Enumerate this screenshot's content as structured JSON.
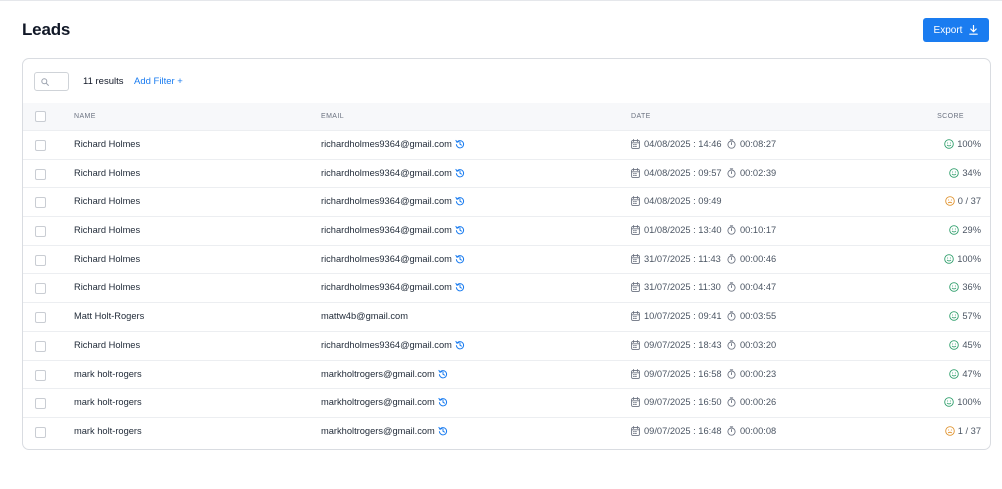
{
  "page": {
    "title": "Leads"
  },
  "toolbar": {
    "export_label": "Export",
    "results": "11 results",
    "add_filter": "Add Filter +"
  },
  "columns": {
    "name": "NAME",
    "email": "EMAIL",
    "date": "DATE",
    "score": "SCORE"
  },
  "colors": {
    "accent": "#1a7cf0",
    "good": "#2e9e6b",
    "neutral": "#e0932f"
  },
  "rows": [
    {
      "name": "Richard Holmes",
      "email": "richardholmes9364@gmail.com",
      "history": true,
      "date": "04/08/2025 : 14:46",
      "duration": "00:08:27",
      "score": "100%",
      "mood": "good"
    },
    {
      "name": "Richard Holmes",
      "email": "richardholmes9364@gmail.com",
      "history": true,
      "date": "04/08/2025 : 09:57",
      "duration": "00:02:39",
      "score": "34%",
      "mood": "good"
    },
    {
      "name": "Richard Holmes",
      "email": "richardholmes9364@gmail.com",
      "history": true,
      "date": "04/08/2025 : 09:49",
      "duration": "",
      "score": "0 / 37",
      "mood": "neutral"
    },
    {
      "name": "Richard Holmes",
      "email": "richardholmes9364@gmail.com",
      "history": true,
      "date": "01/08/2025 : 13:40",
      "duration": "00:10:17",
      "score": "29%",
      "mood": "good"
    },
    {
      "name": "Richard Holmes",
      "email": "richardholmes9364@gmail.com",
      "history": true,
      "date": "31/07/2025 : 11:43",
      "duration": "00:00:46",
      "score": "100%",
      "mood": "good"
    },
    {
      "name": "Richard Holmes",
      "email": "richardholmes9364@gmail.com",
      "history": true,
      "date": "31/07/2025 : 11:30",
      "duration": "00:04:47",
      "score": "36%",
      "mood": "good"
    },
    {
      "name": "Matt Holt-Rogers",
      "email": "mattw4b@gmail.com",
      "history": false,
      "date": "10/07/2025 : 09:41",
      "duration": "00:03:55",
      "score": "57%",
      "mood": "good"
    },
    {
      "name": "Richard Holmes",
      "email": "richardholmes9364@gmail.com",
      "history": true,
      "date": "09/07/2025 : 18:43",
      "duration": "00:03:20",
      "score": "45%",
      "mood": "good"
    },
    {
      "name": "mark holt-rogers",
      "email": "markholtrogers@gmail.com",
      "history": true,
      "date": "09/07/2025 : 16:58",
      "duration": "00:00:23",
      "score": "47%",
      "mood": "good"
    },
    {
      "name": "mark holt-rogers",
      "email": "markholtrogers@gmail.com",
      "history": true,
      "date": "09/07/2025 : 16:50",
      "duration": "00:00:26",
      "score": "100%",
      "mood": "good"
    },
    {
      "name": "mark holt-rogers",
      "email": "markholtrogers@gmail.com",
      "history": true,
      "date": "09/07/2025 : 16:48",
      "duration": "00:00:08",
      "score": "1 / 37",
      "mood": "neutral"
    }
  ]
}
